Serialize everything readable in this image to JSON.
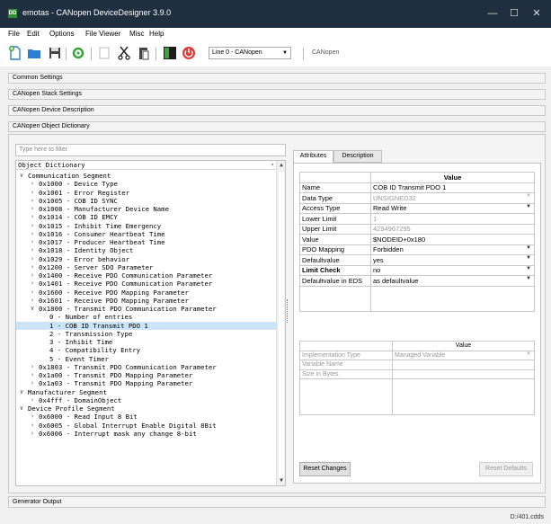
{
  "window": {
    "title": "emotas - CANopen DeviceDesigner 3.9.0",
    "app_icon_text": "DD",
    "controls": [
      "—",
      "☐",
      "✕"
    ]
  },
  "menu": [
    "File",
    "Edit",
    "Options",
    "File Viewer",
    "Misc",
    "Help"
  ],
  "toolbar": {
    "icons": [
      "new-file-icon",
      "open-folder-icon",
      "save-icon",
      "settings-icon",
      "blank-icon",
      "cut-icon",
      "paste-icon",
      "device-icon",
      "power-icon"
    ],
    "line_select": "Line 0 - CANopen",
    "protocol_label": "CANopen"
  },
  "sections": {
    "common": "Common Settings",
    "stack": "CANopen Stack Settings",
    "device": "CANopen Device Description",
    "dictionary": "CANopen Object Dictionary",
    "generator": "Generator Output"
  },
  "filter_placeholder": "Type here to filter",
  "tree": {
    "header": "Object Dictionary",
    "rows": [
      {
        "level": 0,
        "chev": "∨",
        "text": "Communication Segment"
      },
      {
        "level": 1,
        "chev": "›",
        "text": "0x1000 - Device Type"
      },
      {
        "level": 1,
        "chev": "›",
        "text": "0x1001 - Error Register"
      },
      {
        "level": 1,
        "chev": "›",
        "text": "0x1005 - COB ID SYNC"
      },
      {
        "level": 1,
        "chev": "›",
        "text": "0x1008 - Manufacturer Device Name"
      },
      {
        "level": 1,
        "chev": "›",
        "text": "0x1014 - COB ID EMCY"
      },
      {
        "level": 1,
        "chev": "›",
        "text": "0x1015 - Inhibit Time Emergency"
      },
      {
        "level": 1,
        "chev": "›",
        "text": "0x1016 - Consumer Heartbeat Time"
      },
      {
        "level": 1,
        "chev": "›",
        "text": "0x1017 - Producer Heartbeat Time"
      },
      {
        "level": 1,
        "chev": "›",
        "text": "0x1018 - Identity Object"
      },
      {
        "level": 1,
        "chev": "›",
        "text": "0x1029 - Error behavior"
      },
      {
        "level": 1,
        "chev": "›",
        "text": "0x1200 - Server SDO Parameter"
      },
      {
        "level": 1,
        "chev": "›",
        "text": "0x1400 - Receive PDO Communication Parameter"
      },
      {
        "level": 1,
        "chev": "›",
        "text": "0x1401 - Receive PDO Communication Parameter"
      },
      {
        "level": 1,
        "chev": "›",
        "text": "0x1600 - Receive PDO Mapping Parameter"
      },
      {
        "level": 1,
        "chev": "›",
        "text": "0x1601 - Receive PDO Mapping Parameter"
      },
      {
        "level": 1,
        "chev": "∨",
        "text": "0x1800 - Transmit PDO Communication Parameter"
      },
      {
        "level": 2,
        "chev": "",
        "text": "0 - Number of entries"
      },
      {
        "level": 2,
        "chev": "",
        "text": "1 - COB ID Transmit PDO 1",
        "selected": true
      },
      {
        "level": 2,
        "chev": "",
        "text": "2 - Transmission Type"
      },
      {
        "level": 2,
        "chev": "",
        "text": "3 - Inhibit Time"
      },
      {
        "level": 2,
        "chev": "",
        "text": "4 - Compatibility Entry"
      },
      {
        "level": 2,
        "chev": "",
        "text": "5 - Event Timer"
      },
      {
        "level": 1,
        "chev": "›",
        "text": "0x1803 - Transmit PDO Communication Parameter"
      },
      {
        "level": 1,
        "chev": "›",
        "text": "0x1a00 - Transmit PDO Mapping Parameter"
      },
      {
        "level": 1,
        "chev": "›",
        "text": "0x1a03 - Transmit PDO Mapping Parameter"
      },
      {
        "level": 0,
        "chev": "∨",
        "text": "Manufacturer Segment"
      },
      {
        "level": 1,
        "chev": "›",
        "text": "0x4fff - DomainObject"
      },
      {
        "level": 0,
        "chev": "∨",
        "text": "Device Profile Segment"
      },
      {
        "level": 1,
        "chev": "›",
        "text": "0x6000 - Read Input 8 Bit"
      },
      {
        "level": 1,
        "chev": "›",
        "text": "0x6005 - Global Interrupt Enable Digital 8Bit"
      },
      {
        "level": 1,
        "chev": "›",
        "text": "0x6006 - Interrupt mask any change 8-bit"
      }
    ]
  },
  "tabs": [
    "Attributes",
    "Description"
  ],
  "attributes": {
    "header": "Value",
    "rows": [
      {
        "name": "Name",
        "value": "COB ID Transmit PDO 1",
        "dropdown": false,
        "disabled": false,
        "bold": false
      },
      {
        "name": "Data Type",
        "value": "UNSIGNED32",
        "dropdown": true,
        "disabled": true,
        "bold": false
      },
      {
        "name": "Access Type",
        "value": "Read Write",
        "dropdown": true,
        "disabled": false,
        "bold": false
      },
      {
        "name": "Lower Limit",
        "value": "1",
        "dropdown": false,
        "disabled": true,
        "bold": false
      },
      {
        "name": "Upper Limit",
        "value": "4294967295",
        "dropdown": false,
        "disabled": true,
        "bold": false
      },
      {
        "name": "Value",
        "value": "$NODEID+0x180",
        "dropdown": false,
        "disabled": false,
        "bold": false
      },
      {
        "name": "PDO Mapping",
        "value": "Forbidden",
        "dropdown": true,
        "disabled": false,
        "bold": false
      },
      {
        "name": "Defaultvalue",
        "value": "yes",
        "dropdown": true,
        "disabled": false,
        "bold": false
      },
      {
        "name": "Limit Check",
        "value": "no",
        "dropdown": true,
        "disabled": false,
        "bold": true
      },
      {
        "name": "Defaultvalue in EDS",
        "value": "as defaultvalue",
        "dropdown": true,
        "disabled": false,
        "bold": false
      }
    ]
  },
  "implementation": {
    "header": "Value",
    "rows": [
      {
        "name": "Implementation Type",
        "value": "Managed Variable",
        "dropdown": true
      },
      {
        "name": "Variable Name",
        "value": "",
        "dropdown": false
      },
      {
        "name": "Size in Bytes",
        "value": "",
        "dropdown": false
      }
    ]
  },
  "buttons": {
    "reset_changes": "Reset Changes",
    "reset_defaults": "Reset Defaults"
  },
  "status": {
    "path": "D:/401.cdds"
  }
}
